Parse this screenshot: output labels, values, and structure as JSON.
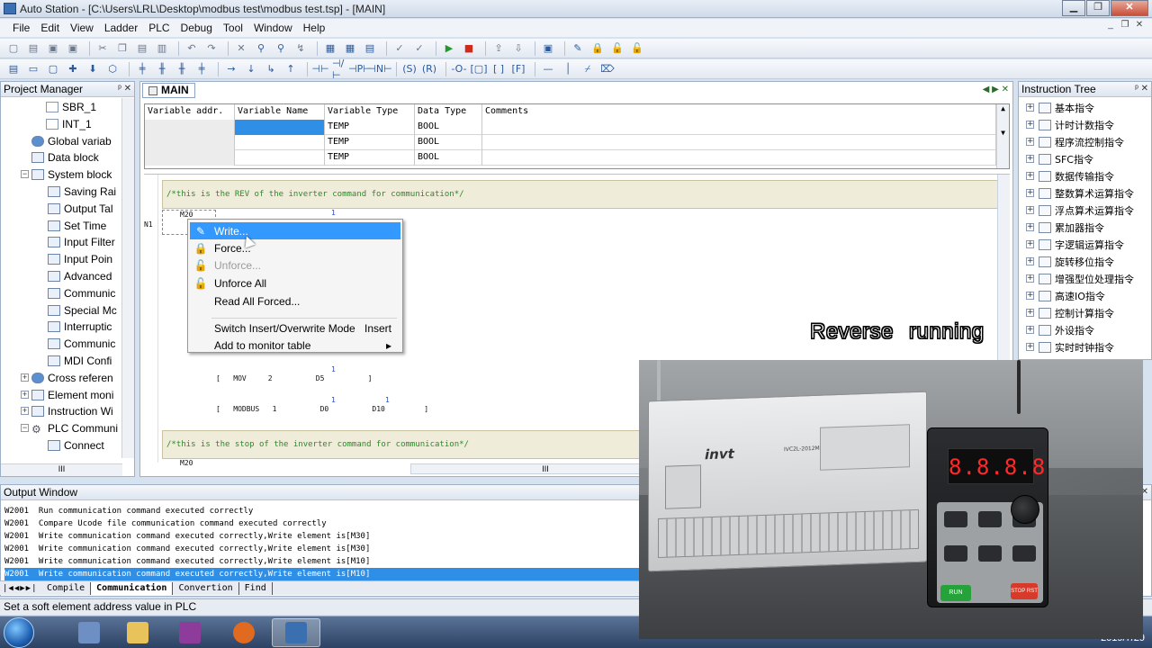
{
  "window": {
    "title": "Auto Station - [C:\\Users\\LRL\\Desktop\\modbus test\\modbus test.tsp] - [MAIN]"
  },
  "menu": [
    "File",
    "Edit",
    "View",
    "Ladder",
    "PLC",
    "Debug",
    "Tool",
    "Window",
    "Help"
  ],
  "project_manager": {
    "title": "Project Manager",
    "items": [
      {
        "label": "SBR_1",
        "icon": "doc-icon"
      },
      {
        "label": "INT_1",
        "icon": "doc-icon"
      },
      {
        "label": "Global variab",
        "icon": "globe-icon"
      },
      {
        "label": "Data block",
        "icon": "block-icon"
      },
      {
        "label": "System block",
        "icon": "system-icon"
      },
      {
        "label": "Saving Rai",
        "icon": "config-icon"
      },
      {
        "label": "Output Tal",
        "icon": "config-icon"
      },
      {
        "label": "Set Time",
        "icon": "config-icon"
      },
      {
        "label": "Input Filter",
        "icon": "config-icon"
      },
      {
        "label": "Input Poin",
        "icon": "config-icon"
      },
      {
        "label": "Advanced",
        "icon": "config-icon"
      },
      {
        "label": "Communic",
        "icon": "config-icon"
      },
      {
        "label": "Special Mc",
        "icon": "config-icon"
      },
      {
        "label": "Interruptic",
        "icon": "config-icon"
      },
      {
        "label": "Communic",
        "icon": "config-icon"
      },
      {
        "label": "MDI Confi",
        "icon": "config-icon"
      },
      {
        "label": "Cross referen",
        "icon": "globe-icon"
      },
      {
        "label": "Element moni",
        "icon": "monitor-icon"
      },
      {
        "label": "Instruction Wi",
        "icon": "wizard-icon"
      },
      {
        "label": "PLC Communi",
        "icon": "wrench-icon"
      },
      {
        "label": "Connect",
        "icon": "connect-icon"
      }
    ],
    "scroll_label": "III"
  },
  "editor": {
    "tab": "MAIN",
    "var_table": {
      "headers": [
        "Variable addr.",
        "Variable Name",
        "Variable Type",
        "Data Type",
        "Comments"
      ],
      "rows": [
        [
          "",
          "",
          "TEMP",
          "BOOL",
          ""
        ],
        [
          "",
          "",
          "TEMP",
          "BOOL",
          ""
        ],
        [
          "",
          "",
          "TEMP",
          "BOOL",
          ""
        ]
      ]
    },
    "ladder": {
      "comment1": "/*this is the REV of the inverter command for communication*/",
      "comment2": "/*this is the stop of the inverter command for communication*/",
      "network": "N1",
      "contact": "M20",
      "contact_bottom": "M20",
      "one": "1",
      "mov": "[   MOV     2          D5          ]",
      "modbus": "[   MODBUS   1          D0          D10         ]",
      "scroll_label": "III"
    }
  },
  "context_menu": {
    "items": [
      {
        "label": "Write...",
        "icon": "pencil-icon",
        "shortcut": "",
        "state": "highlight"
      },
      {
        "label": "Force...",
        "icon": "lock-icon",
        "shortcut": "",
        "state": "normal"
      },
      {
        "label": "Unforce...",
        "icon": "unlock-icon",
        "shortcut": "",
        "state": "disabled"
      },
      {
        "label": "Unforce All",
        "icon": "unlock-all-icon",
        "shortcut": "",
        "state": "normal"
      },
      {
        "label": "Read All Forced...",
        "icon": "",
        "shortcut": "",
        "state": "normal"
      },
      {
        "label": "Switch Insert/Overwrite Mode",
        "icon": "",
        "shortcut": "Insert",
        "state": "normal"
      },
      {
        "label": "Add to monitor table",
        "icon": "",
        "shortcut": "▸",
        "state": "normal"
      }
    ]
  },
  "instruction_tree": {
    "title": "Instruction Tree",
    "items": [
      "基本指令",
      "计时计数指令",
      "程序流控制指令",
      "SFC指令",
      "数据传输指令",
      "整数算术运算指令",
      "浮点算术运算指令",
      "累加器指令",
      "字逻辑运算指令",
      "旋转移位指令",
      "增强型位处理指令",
      "高速IO指令",
      "控制计算指令",
      "外设指令",
      "实时时钟指令"
    ]
  },
  "output": {
    "title": "Output Window",
    "lines": [
      "W2001  Run communication command executed correctly",
      "W2001  Compare Ucode file communication command executed correctly",
      "W2001  Write communication command executed correctly,Write element is[M30]",
      "W2001  Write communication command executed correctly,Write element is[M30]",
      "W2001  Write communication command executed correctly,Write element is[M10]",
      "W2001  Write communication command executed correctly,Write element is[M10]"
    ],
    "tabs": [
      "Compile",
      "Communication",
      "Convertion",
      "Find"
    ],
    "active_tab": "Communication"
  },
  "status": "Set a soft element address value in PLC",
  "video": {
    "caption": "Reverse running",
    "plc_brand": "invt",
    "plc_model": "IVC2L-2012MAT",
    "vfd_display": "8.8.8.8",
    "run_label": "RUN",
    "stop_label": "STOP RST"
  },
  "taskbar": {
    "clock": "2019/7/29"
  }
}
